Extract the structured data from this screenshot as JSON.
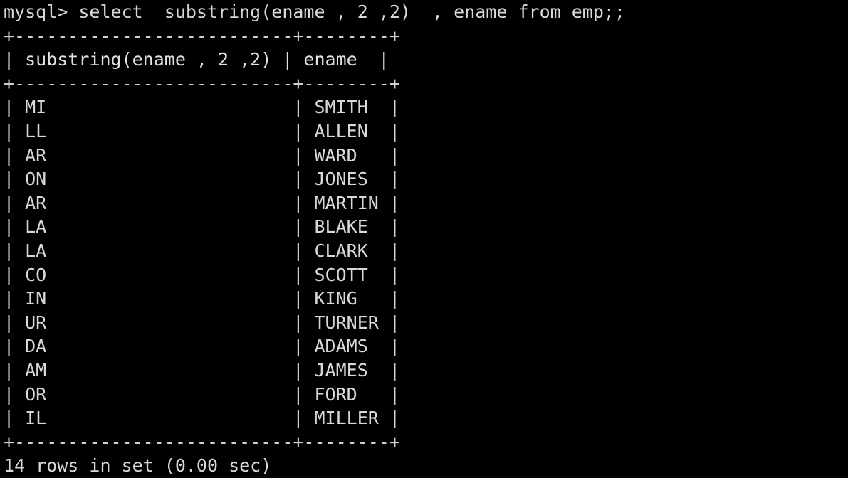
{
  "terminal": {
    "prompt": "mysql> ",
    "query": "select  substring(ename , 2 ,2)  , ename from emp;;",
    "prompt_line": "mysql> select  substring(ename , 2 ,2)  , ename from emp;;",
    "colors": {
      "background": "#000000",
      "foreground": "#d8d8d8"
    },
    "table": {
      "rule_top": "+--------------------------+--------+",
      "rule_mid": "+--------------------------+--------+",
      "rule_bottom": "+--------------------------+--------+",
      "header_line": "| substring(ename , 2 ,2) | ename  |",
      "columns": [
        "substring(ename , 2 ,2)",
        "ename"
      ],
      "rows": [
        {
          "substring": "MI",
          "ename": "SMITH",
          "line": "| MI                       | SMITH  |"
        },
        {
          "substring": "LL",
          "ename": "ALLEN",
          "line": "| LL                       | ALLEN  |"
        },
        {
          "substring": "AR",
          "ename": "WARD",
          "line": "| AR                       | WARD   |"
        },
        {
          "substring": "ON",
          "ename": "JONES",
          "line": "| ON                       | JONES  |"
        },
        {
          "substring": "AR",
          "ename": "MARTIN",
          "line": "| AR                       | MARTIN |"
        },
        {
          "substring": "LA",
          "ename": "BLAKE",
          "line": "| LA                       | BLAKE  |"
        },
        {
          "substring": "LA",
          "ename": "CLARK",
          "line": "| LA                       | CLARK  |"
        },
        {
          "substring": "CO",
          "ename": "SCOTT",
          "line": "| CO                       | SCOTT  |"
        },
        {
          "substring": "IN",
          "ename": "KING",
          "line": "| IN                       | KING   |"
        },
        {
          "substring": "UR",
          "ename": "TURNER",
          "line": "| UR                       | TURNER |"
        },
        {
          "substring": "DA",
          "ename": "ADAMS",
          "line": "| DA                       | ADAMS  |"
        },
        {
          "substring": "AM",
          "ename": "JAMES",
          "line": "| AM                       | JAMES  |"
        },
        {
          "substring": "OR",
          "ename": "FORD",
          "line": "| OR                       | FORD   |"
        },
        {
          "substring": "IL",
          "ename": "MILLER",
          "line": "| IL                       | MILLER |"
        }
      ]
    },
    "status": "14 rows in set (0.00 sec)",
    "row_count": 14,
    "elapsed": "0.00 sec"
  }
}
